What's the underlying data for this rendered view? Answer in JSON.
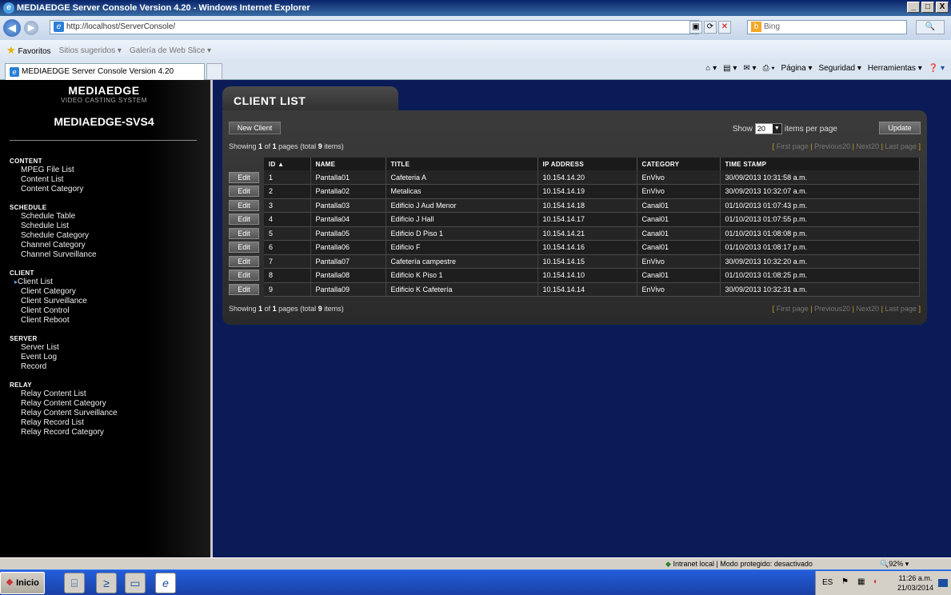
{
  "window": {
    "title": "MEDIAEDGE Server Console Version 4.20 - Windows Internet Explorer",
    "buttons": [
      "_",
      "□",
      "X"
    ]
  },
  "browser": {
    "url": "http://localhost/ServerConsole/",
    "search_placeholder": "Bing",
    "favorites": {
      "label": "Favoritos",
      "suggested": "Sitios sugeridos",
      "gallery": "Galería de Web Slice"
    },
    "tab_title": "MEDIAEDGE Server Console Version 4.20",
    "commands": {
      "page": "Página",
      "security": "Seguridad",
      "tools": "Herramientas"
    }
  },
  "sidebar": {
    "brand": "MEDIAEDGE",
    "brand_sub": "VIDEO CASTING SYSTEM",
    "server_name": "MEDIAEDGE-SVS4",
    "sections": [
      {
        "heading": "CONTENT",
        "items": [
          "MPEG File List",
          "Content List",
          "Content Category"
        ]
      },
      {
        "heading": "SCHEDULE",
        "items": [
          "Schedule Table",
          "Schedule List",
          "Schedule Category",
          "Channel Category",
          "Channel Surveillance"
        ]
      },
      {
        "heading": "CLIENT",
        "items": [
          "Client List",
          "Client Category",
          "Client Surveillance",
          "Client Control",
          "Client Reboot"
        ],
        "current": "Client List"
      },
      {
        "heading": "SERVER",
        "items": [
          "Server List",
          "Event Log",
          "Record"
        ]
      },
      {
        "heading": "RELAY",
        "items": [
          "Relay Content List",
          "Relay Content Category",
          "Relay Content Surveillance",
          "Relay Record List",
          "Relay Record Category"
        ]
      }
    ]
  },
  "main": {
    "title": "CLIENT LIST",
    "new_client": "New Client",
    "show_label": "Show",
    "show_value": "20",
    "show_suffix": "items per page",
    "update": "Update",
    "showing_prefix": "Showing",
    "showing_page": "1",
    "showing_of": "of",
    "showing_pages": "1",
    "showing_pages_label": "pages (total",
    "showing_total": "9",
    "showing_items": "items)",
    "pager": {
      "first": "First page",
      "prev": "Previous20",
      "next": "Next20",
      "last": "Last page"
    },
    "columns": [
      "ID ▲",
      "NAME",
      "TITLE",
      "IP ADDRESS",
      "CATEGORY",
      "TIME STAMP"
    ],
    "edit_label": "Edit",
    "rows": [
      [
        "1",
        "Pantalla01",
        "Cafeteria A",
        "10.154.14.20",
        "EnVivo",
        "30/09/2013 10:31:58 a.m."
      ],
      [
        "2",
        "Pantalla02",
        "Metalicas",
        "10.154.14.19",
        "EnVivo",
        "30/09/2013 10:32:07 a.m."
      ],
      [
        "3",
        "Pantalla03",
        "Edificio J Aud Menor",
        "10.154.14.18",
        "Canal01",
        "01/10/2013 01:07:43 p.m."
      ],
      [
        "4",
        "Pantalla04",
        "Edificio J Hall",
        "10.154.14.17",
        "Canal01",
        "01/10/2013 01:07:55 p.m."
      ],
      [
        "5",
        "Pantalla05",
        "Edificio D Piso 1",
        "10.154.14.21",
        "Canal01",
        "01/10/2013 01:08:08 p.m."
      ],
      [
        "6",
        "Pantalla06",
        "Edificio F",
        "10.154.14.16",
        "Canal01",
        "01/10/2013 01:08:17 p.m."
      ],
      [
        "7",
        "Pantalla07",
        "Cafetería campestre",
        "10.154.14.15",
        "EnVivo",
        "30/09/2013 10:32:20 a.m."
      ],
      [
        "8",
        "Pantalla08",
        "Edificio K Piso 1",
        "10.154.14.10",
        "Canal01",
        "01/10/2013 01:08:25 p.m."
      ],
      [
        "9",
        "Pantalla09",
        "Edificio K Cafetería",
        "10.154.14.14",
        "EnVivo",
        "30/09/2013 10:32:31 a.m."
      ]
    ]
  },
  "statusbar": {
    "zone": "Intranet local | Modo protegido: desactivado",
    "zoom": "92%"
  },
  "taskbar": {
    "start": "Inicio",
    "lang": "ES",
    "time": "11:26 a.m.",
    "date": "21/03/2014"
  },
  "colors": {
    "nav_bg": "#000000",
    "main_bg": "#0b1b58",
    "panel_bg": "#333333",
    "accent": "#c9a227"
  }
}
